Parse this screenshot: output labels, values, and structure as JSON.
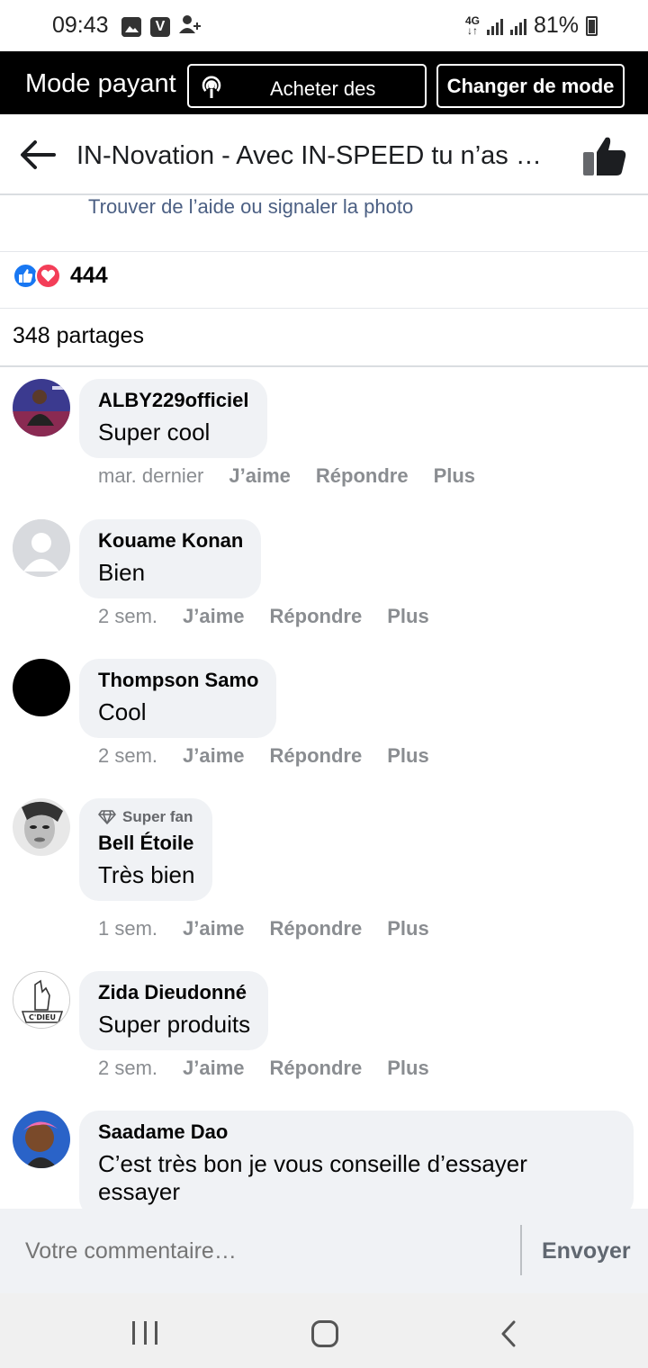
{
  "status_bar": {
    "time": "09:43",
    "network": "4G",
    "battery": "81%",
    "icons": [
      "gallery-icon",
      "v-app-icon",
      "add-contact-icon",
      "signal-icon",
      "battery-icon"
    ]
  },
  "mode_bar": {
    "title": "Mode payant",
    "buy_label": "Acheter des",
    "change_label": "Changer de mode"
  },
  "header": {
    "title": "IN-Novation - Avec IN-SPEED tu n’as …"
  },
  "help_link": "Trouver de l’aide ou signaler la photo",
  "reactions": {
    "count": "444"
  },
  "shares": "348 partages",
  "action_labels": {
    "like": "J’aime",
    "reply": "Répondre",
    "more": "Plus"
  },
  "comments": [
    {
      "author": "ALBY229officiel",
      "text": "Super cool",
      "time": "mar. dernier"
    },
    {
      "author": "Kouame Konan",
      "text": "Bien",
      "time": "2 sem."
    },
    {
      "author": "Thompson Samo",
      "text": "Cool",
      "time": "2 sem."
    },
    {
      "badge": "Super fan",
      "author": "Bell Étoile",
      "text": "Très bien",
      "time": "1 sem."
    },
    {
      "author": "Zida Dieudonné",
      "text": "Super produits",
      "time": "2 sem."
    },
    {
      "author": "Saadame Dao",
      "text": "C’est très bon je vous conseille d’essayer essayer"
    }
  ],
  "avatar_labels": {
    "zida": "C'DIEU"
  },
  "composer": {
    "placeholder": "Votre commentaire…",
    "send_label": "Envoyer"
  },
  "colors": {
    "mode_bar_bg": "#000000",
    "link": "#4b5f83",
    "like_blue": "#1877f2",
    "love_red": "#f33e58",
    "bubble_bg": "#f0f2f5"
  }
}
